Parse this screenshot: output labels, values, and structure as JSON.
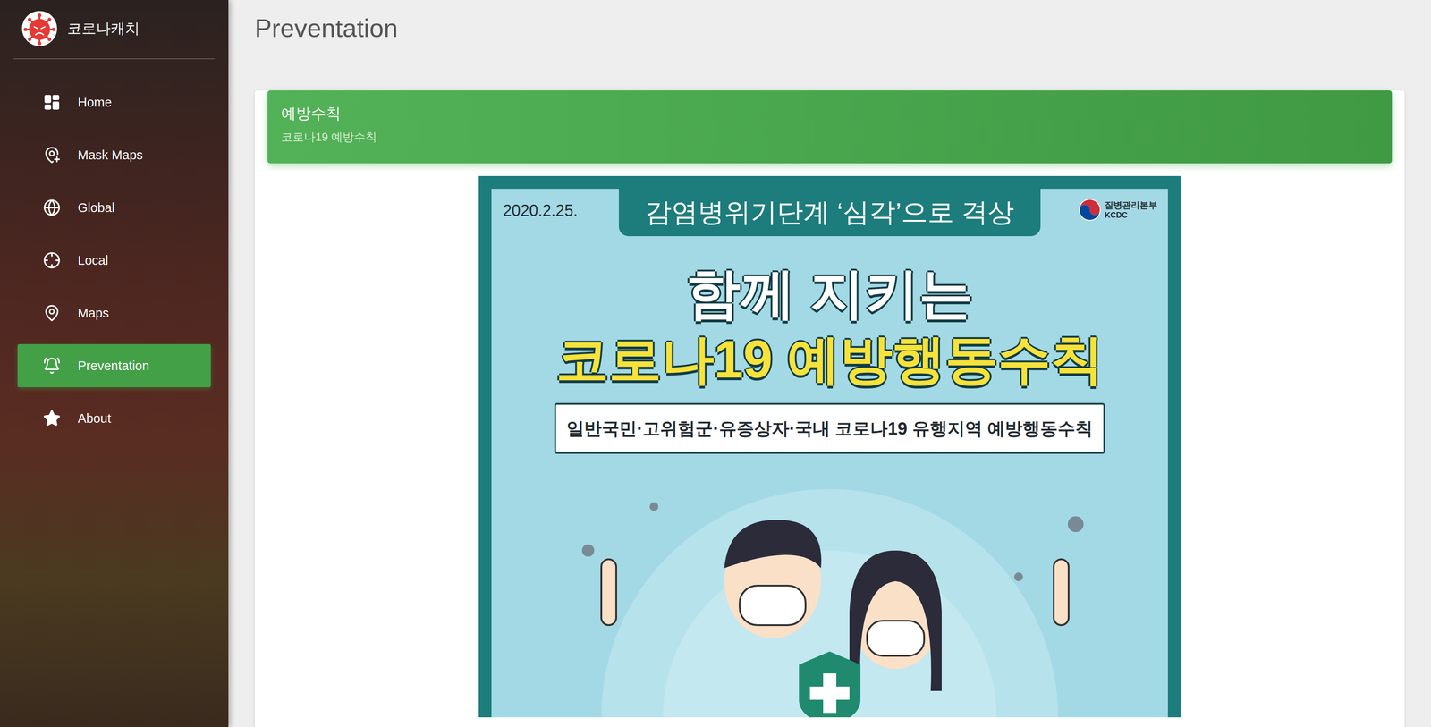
{
  "sidebar": {
    "brand": "코로나캐치",
    "items": [
      {
        "label": "Home",
        "selected": false
      },
      {
        "label": "Mask Maps",
        "selected": false
      },
      {
        "label": "Global",
        "selected": false
      },
      {
        "label": "Local",
        "selected": false
      },
      {
        "label": "Maps",
        "selected": false
      },
      {
        "label": "Preventation",
        "selected": true
      },
      {
        "label": "About",
        "selected": false
      }
    ]
  },
  "page": {
    "title": "Preventation"
  },
  "card": {
    "title": "예방수칙",
    "subtitle": "코로나19 예방수칙"
  },
  "poster": {
    "date": "2020.2.25.",
    "banner": "감염병위기단계 ‘심각’으로 격상",
    "agency": "질병관리본부",
    "agency_en": "KCDC",
    "headline": "함께 지키는",
    "title": "코로나19 예방행동수칙",
    "subtitle": "일반국민·고위험군·유증상자·국내 코로나19 유행지역 예방행동수칙"
  }
}
